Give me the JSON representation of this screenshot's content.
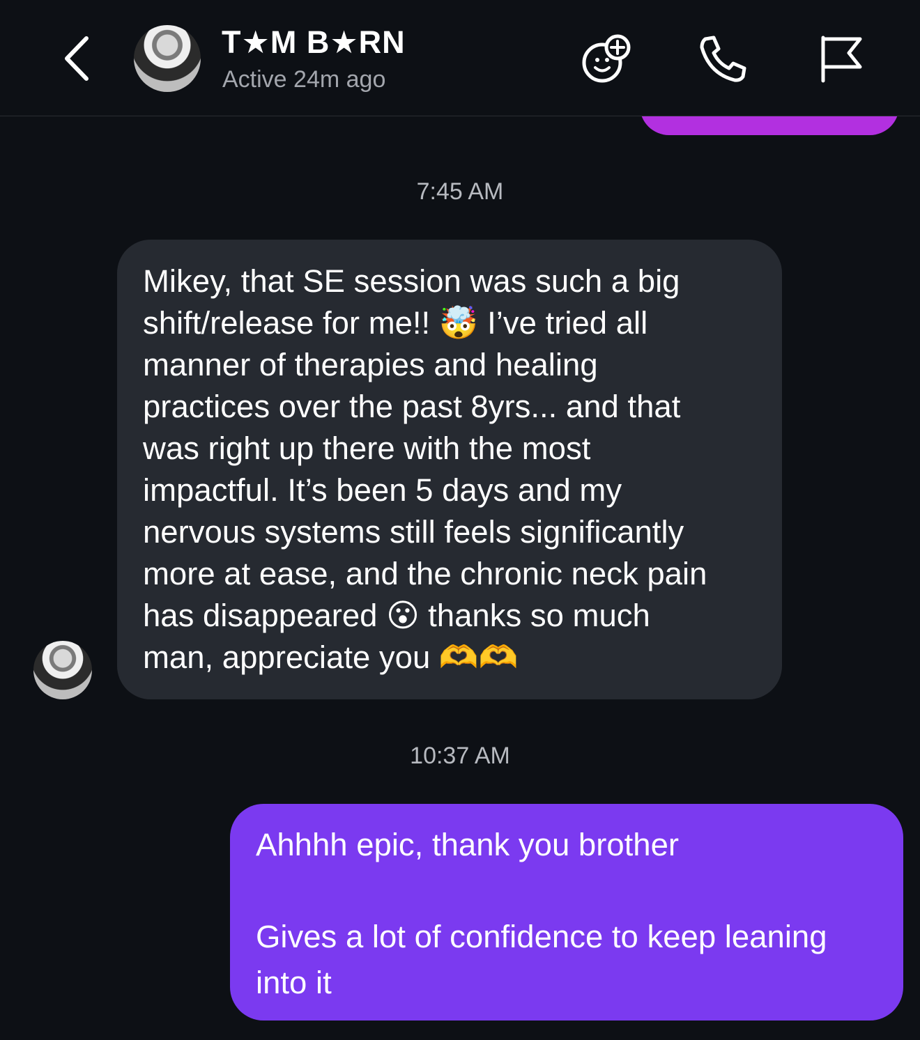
{
  "header": {
    "contact_name": "T★M B★RN",
    "status": "Active 24m ago",
    "icons": {
      "back": "chevron-left-icon",
      "effects": "add-effect-smiley-icon",
      "call": "phone-icon",
      "report": "flag-icon"
    }
  },
  "messages": [
    {
      "type": "timestamp",
      "text": "7:45 AM"
    },
    {
      "type": "incoming",
      "text": "Mikey, that SE session was such a big\nshift/release for me!! 🤯 I’ve tried all\nmanner of therapies and healing\npractices over the past 8yrs... and that\nwas right up there with the most\nimpactful. It’s been 5 days and my\nnervous systems still feels significantly\nmore at ease, and the chronic neck pain\nhas disappeared 😮 thanks so much\nman, appreciate you 🫶🫶"
    },
    {
      "type": "timestamp",
      "text": "10:37 AM"
    },
    {
      "type": "outgoing",
      "text": "Ahhhh epic, thank you brother\n\nGives a lot of confidence to keep leaning\ninto it"
    }
  ],
  "colors": {
    "background": "#0d1015",
    "incoming_bubble": "#262a31",
    "outgoing_bubble": "#7b3af0",
    "previous_outgoing_bubble": "#b230e0",
    "secondary_text": "#a3a6ad"
  }
}
